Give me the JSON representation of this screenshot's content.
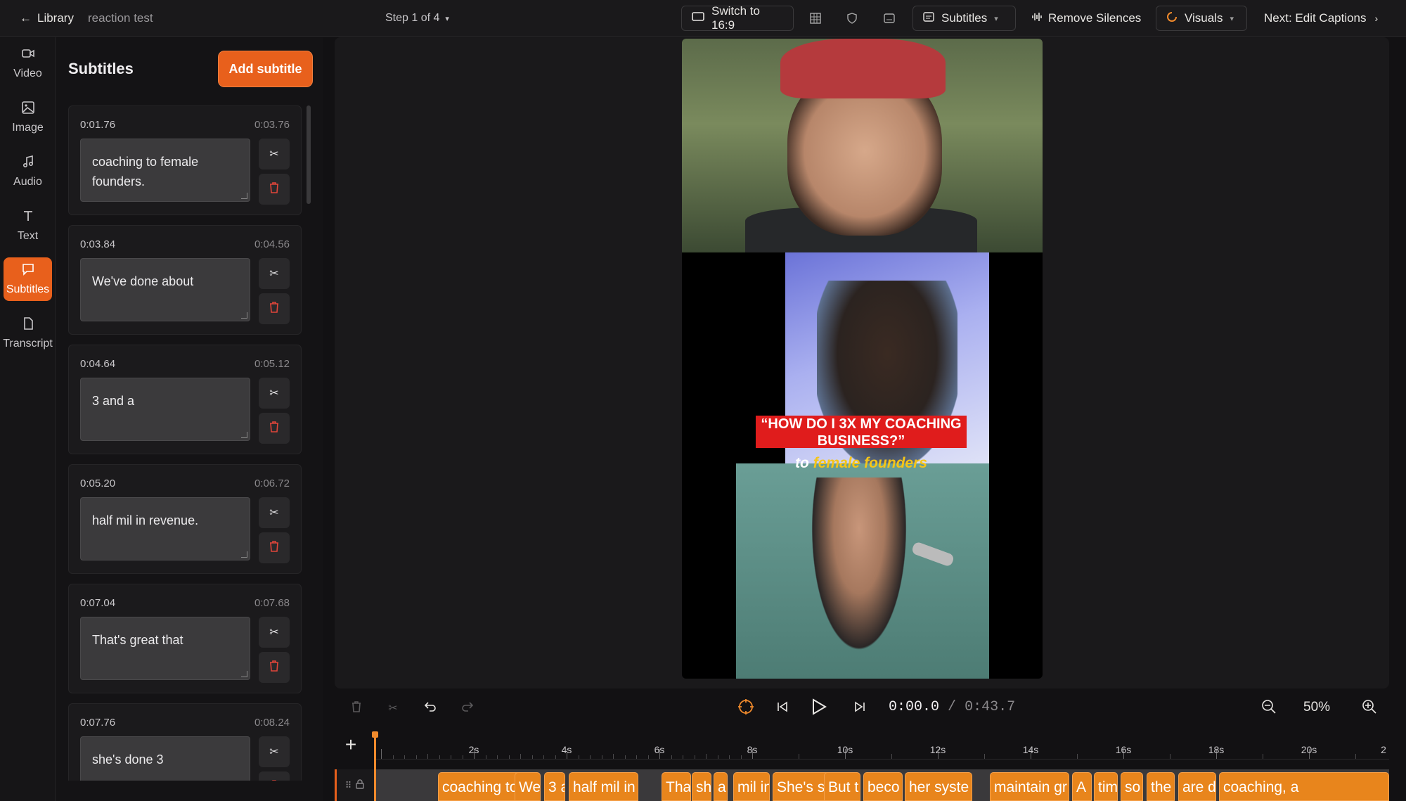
{
  "topbar": {
    "back_label": "Library",
    "project_name": "reaction test",
    "step_label": "Step 1 of 4",
    "switch_label": "Switch to 16:9",
    "subtitles_label": "Subtitles",
    "remove_silences_label": "Remove Silences",
    "visuals_label": "Visuals",
    "next_label": "Next: Edit Captions"
  },
  "rail": {
    "items": [
      {
        "label": "Video",
        "icon": "video-camera-icon"
      },
      {
        "label": "Image",
        "icon": "image-icon"
      },
      {
        "label": "Audio",
        "icon": "music-note-icon"
      },
      {
        "label": "Text",
        "icon": "text-t-icon"
      },
      {
        "label": "Subtitles",
        "icon": "speech-bubble-icon",
        "active": true
      },
      {
        "label": "Transcript",
        "icon": "document-icon"
      }
    ]
  },
  "panel": {
    "title": "Subtitles",
    "add_label": "Add subtitle",
    "subtitles": [
      {
        "start": "0:01.76",
        "end": "0:03.76",
        "text": "coaching to female founders."
      },
      {
        "start": "0:03.84",
        "end": "0:04.56",
        "text": "We've done about"
      },
      {
        "start": "0:04.64",
        "end": "0:05.12",
        "text": "3 and a"
      },
      {
        "start": "0:05.20",
        "end": "0:06.72",
        "text": "half mil in revenue."
      },
      {
        "start": "0:07.04",
        "end": "0:07.68",
        "text": "That's great that"
      },
      {
        "start": "0:07.76",
        "end": "0:08.24",
        "text": "she's done 3"
      }
    ]
  },
  "video": {
    "caption_line": "“HOW DO I 3X MY COACHING BUSINESS?”",
    "caption_sub_prefix": "to ",
    "caption_sub_highlight": "female founders"
  },
  "controls": {
    "current_time": "0:00.0",
    "separator": "/",
    "duration": "0:43.7",
    "zoom": "50%"
  },
  "timeline": {
    "ticks": [
      "2s",
      "4s",
      "6s",
      "8s",
      "10s",
      "12s",
      "14s",
      "16s",
      "18s",
      "20s",
      "2"
    ],
    "clips": [
      "coaching to",
      "We'",
      "3 a",
      "half mil in",
      "Tha",
      "sh",
      "a",
      "mil in",
      "She's se",
      "But t",
      "beco",
      "her syste",
      "maintain gr",
      "A",
      "tim",
      "so",
      "the",
      "are do",
      "coaching, a"
    ]
  },
  "colors": {
    "accent": "#e8601c",
    "clip": "#e8851c",
    "trash": "#e0453a"
  }
}
